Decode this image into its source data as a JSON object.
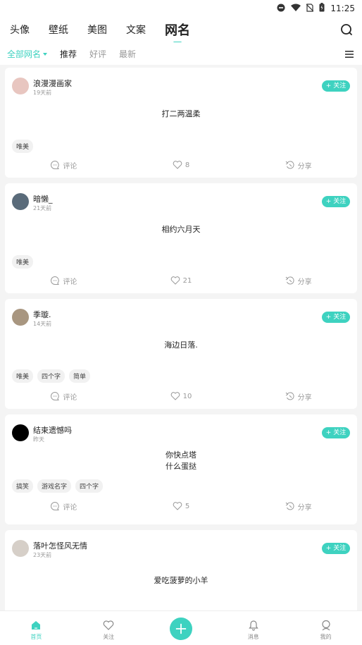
{
  "status_bar": {
    "time": "11:25"
  },
  "top_nav": {
    "tabs": [
      "头像",
      "壁纸",
      "美图",
      "文案",
      "网名"
    ],
    "active": "网名"
  },
  "sub_nav": {
    "items": [
      "全部网名",
      "推荐",
      "好评",
      "最新"
    ]
  },
  "cards": [
    {
      "username": "浪漫漫画家",
      "time": "19天前",
      "follow": "+ 关注",
      "content": [
        "打二两温柔"
      ],
      "tags": [
        "唯美"
      ],
      "comment": "评论",
      "likes": "8",
      "share": "分享"
    },
    {
      "username": "暗懒_",
      "time": "21天前",
      "follow": "+ 关注",
      "content": [
        "相约六月天"
      ],
      "tags": [
        "唯美"
      ],
      "comment": "评论",
      "likes": "21",
      "share": "分享"
    },
    {
      "username": "季璇.",
      "time": "14天前",
      "follow": "+ 关注",
      "content": [
        "海边日落."
      ],
      "tags": [
        "唯美",
        "四个字",
        "简单"
      ],
      "comment": "评论",
      "likes": "10",
      "share": "分享"
    },
    {
      "username": "结束遗憾吗",
      "time": "昨天",
      "follow": "+ 关注",
      "content": [
        "你快点塔",
        "什么蛋挞"
      ],
      "tags": [
        "搞笑",
        "游戏名字",
        "四个字"
      ],
      "comment": "评论",
      "likes": "5",
      "share": "分享"
    },
    {
      "username": "落叶怎怪风无情",
      "time": "23天前",
      "follow": "+ 关注",
      "content": [
        "爱吃菠萝的小羊"
      ],
      "tags": [],
      "comment": "",
      "likes": "",
      "share": ""
    }
  ],
  "bottom_nav": {
    "items": [
      "首页",
      "关注",
      "",
      "消息",
      "我的"
    ]
  },
  "colors": {
    "accent": "#3ed2c0"
  }
}
